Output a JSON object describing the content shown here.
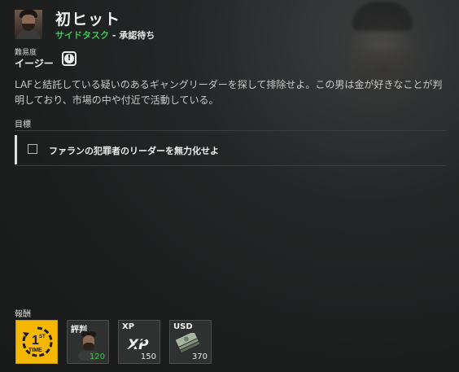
{
  "mission": {
    "title": "初ヒット",
    "type": "サイドタスク",
    "separator": " - ",
    "status": "承認待ち",
    "difficulty_label": "難易度",
    "difficulty_value": "イージー",
    "description": "LAFと結託している疑いのあるギャングリーダーを探して排除せよ。この男は金が好きなことが判明しており、市場の中や付近で活動している。"
  },
  "objectives": {
    "label": "目標",
    "items": [
      {
        "text": "ファランの犯罪者のリーダーを無力化せよ",
        "completed": false
      }
    ]
  },
  "rewards": {
    "label": "報酬",
    "items": [
      {
        "id": "first_time",
        "header": "",
        "amount": "",
        "icon": "first-time-icon",
        "color": "#f5b700"
      },
      {
        "id": "reputation",
        "header": "評判",
        "amount": "120",
        "icon": "faction-leader-portrait-icon",
        "amount_color": "#38c653"
      },
      {
        "id": "xp",
        "header": "XP",
        "amount": "150",
        "icon": "xp-icon"
      },
      {
        "id": "usd",
        "header": "USD",
        "amount": "370",
        "icon": "cash-stack-icon"
      }
    ]
  },
  "colors": {
    "accent_green": "#38c653",
    "first_time_yellow": "#f5b700"
  }
}
